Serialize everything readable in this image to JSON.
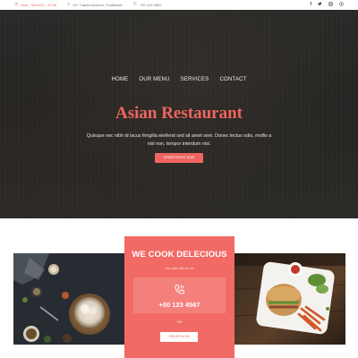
{
  "topbar": {
    "hours": "Mon - Sat 8:00 - 22:00",
    "address": "147 Capitol Avenue, Scottsdale",
    "phone": "+00 123 4567",
    "social": [
      "facebook",
      "twitter",
      "instagram",
      "pinterest"
    ]
  },
  "hero": {
    "nav": [
      "HOME",
      "OUR MENU",
      "SERVICES",
      "CONTACT"
    ],
    "title": "Asian Restaurant",
    "text": "Quisque nec nibh id lacus fringilla eleifend sed sit amet sem. Donec lectus odio, mollis a nisl non, tempor interdum nisl.",
    "button": "ORDER RIGHT NOW"
  },
  "promo": {
    "title": "WE COOK DELECIOUS",
    "sub": "You can call us on:",
    "phone": "+00 123 4567",
    "or": "OR",
    "button": "ORDER NOW"
  },
  "colors": {
    "accent": "#f0655f",
    "card": "#f26a65",
    "hero_bg": "#282725"
  }
}
